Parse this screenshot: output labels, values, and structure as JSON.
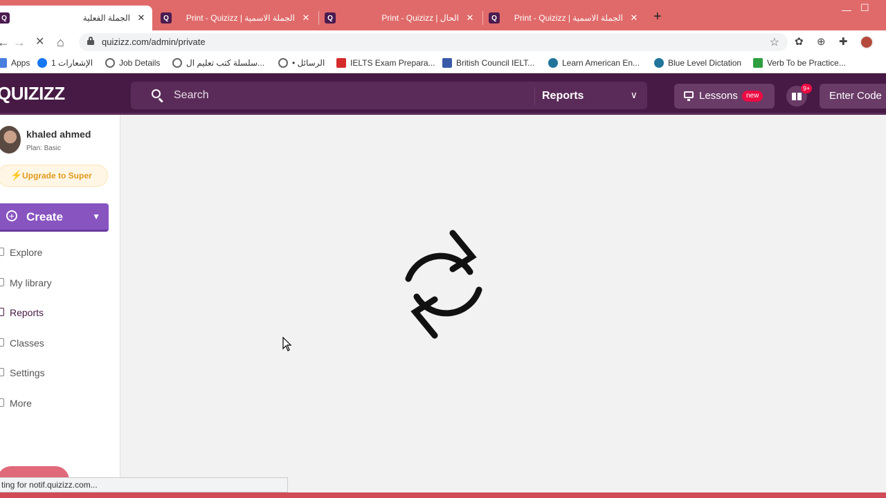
{
  "browser": {
    "tabs": [
      {
        "title": "الجملة الفعلية",
        "active": true
      },
      {
        "title": "Print - Quizizz | الجملة الاسمية",
        "active": false
      },
      {
        "title": "Print - Quizizz | الحال",
        "active": false
      },
      {
        "title": "Print - Quizizz | الجملة الاسمية",
        "active": false
      }
    ],
    "tab_favicon": "Q",
    "new_tab_icon": "+",
    "url": "quizizz.com/admin/private",
    "bookmarks": [
      {
        "label": "Apps",
        "icon": "apps-grid-icon",
        "color": "#4a7fe0"
      },
      {
        "label": "1 الإشعارات",
        "icon": "facebook-icon",
        "color": "#1877f2"
      },
      {
        "label": "Job Details",
        "icon": "globe-icon",
        "color": "#666666"
      },
      {
        "label": "سلسلة كتب تعليم ال...",
        "icon": "globe-icon",
        "color": "#666666"
      },
      {
        "label": "• الرسائل",
        "icon": "globe-icon",
        "color": "#666666"
      },
      {
        "label": "IELTS Exam Prepara...",
        "icon": "ielts-icon",
        "color": "#d62b2b"
      },
      {
        "label": "British Council IELT...",
        "icon": "ors-icon",
        "color": "#3a5aa8"
      },
      {
        "label": "Learn American En...",
        "icon": "wordpress-icon",
        "color": "#21759b"
      },
      {
        "label": "Blue Level Dictation",
        "icon": "wordpress-icon",
        "color": "#21759b"
      },
      {
        "label": "Verb To be Practice...",
        "icon": "isl-icon",
        "color": "#2e9e3f"
      }
    ],
    "status_text": "ting for notif.quizizz.com..."
  },
  "header": {
    "logo": "QUIZIZZ",
    "search_placeholder": "Search",
    "search_scope": "Reports",
    "lessons_label": "Lessons",
    "lessons_badge": "new",
    "gift_badge": "9+",
    "enter_code_label": "Enter Code"
  },
  "sidebar": {
    "user_name": "khaled ahmed",
    "plan": "Plan: Basic",
    "upgrade_label": "Upgrade to Super",
    "create_label": "Create",
    "items": [
      {
        "label": "Explore",
        "active": false
      },
      {
        "label": "My library",
        "active": false
      },
      {
        "label": "Reports",
        "active": true
      },
      {
        "label": "Classes",
        "active": false
      },
      {
        "label": "Settings",
        "active": false
      },
      {
        "label": "More",
        "active": false
      }
    ]
  },
  "colors": {
    "browser_frame": "#e06a6a",
    "header_bg": "#461a44",
    "accent_purple": "#8854c0",
    "upgrade_text": "#e09a1b",
    "badge_red": "#ec0b43"
  },
  "main": {
    "state": "loading",
    "loader_icon": "refresh-icon"
  }
}
